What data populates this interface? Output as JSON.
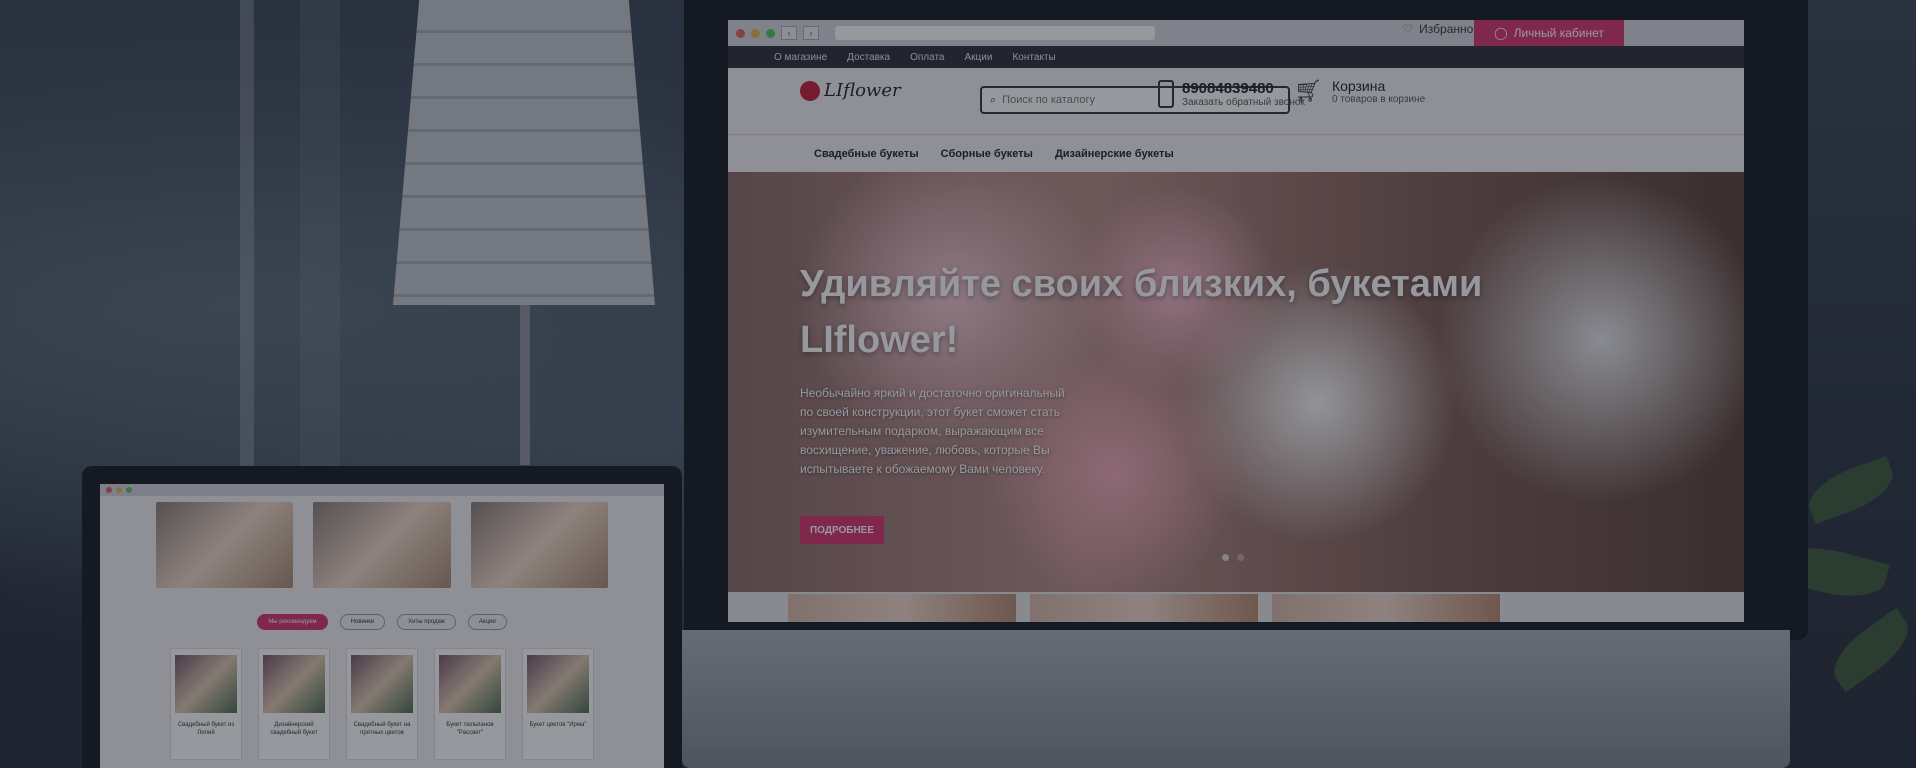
{
  "browser": {
    "favorites_label": "Избранное",
    "account_label": "Личный кабинет",
    "back": "‹",
    "forward": "›"
  },
  "topnav": [
    "О магазине",
    "Доставка",
    "Оплата",
    "Акции",
    "Контакты"
  ],
  "header": {
    "logo_text": "LIflower",
    "search_placeholder": "Поиск по каталогу",
    "phone": "89084839480",
    "phone_sub": "Заказать обратный звонок",
    "cart_title": "Корзина",
    "cart_sub": "0 товаров в корзине",
    "cart_icon": "cart-icon",
    "search_icon": "search-icon",
    "phone_icon": "phone-icon"
  },
  "catnav": [
    "Свадебные букеты",
    "Сборные букеты",
    "Дизайнерские букеты"
  ],
  "hero": {
    "title": "Удивляйте своих близких, букетами LIflower!",
    "text": "Необычайно яркий и достаточно оригинальный по своей конструкции, этот букет сможет стать изумительным подарком, выражающим все восхищение, уважение, любовь, которые Вы испытываете к обожаемому Вами человеку.",
    "button": "ПОДРОБНЕЕ"
  },
  "laptop": {
    "tabs": [
      "Мы рекомендуем",
      "Новинки",
      "Хиты продаж",
      "Акции"
    ],
    "products": [
      "Свадебный букет из Лилий",
      "Дизайнерский свадебный букет",
      "Свадебный букет на прятных цветов",
      "Букет тюльпанов \"Рассвет\"",
      "Букет цветов \"Ирма\""
    ]
  },
  "colors": {
    "accent": "#d6336c",
    "nav_bg": "#2d2f3a",
    "header_bg": "#f3f1f4"
  }
}
